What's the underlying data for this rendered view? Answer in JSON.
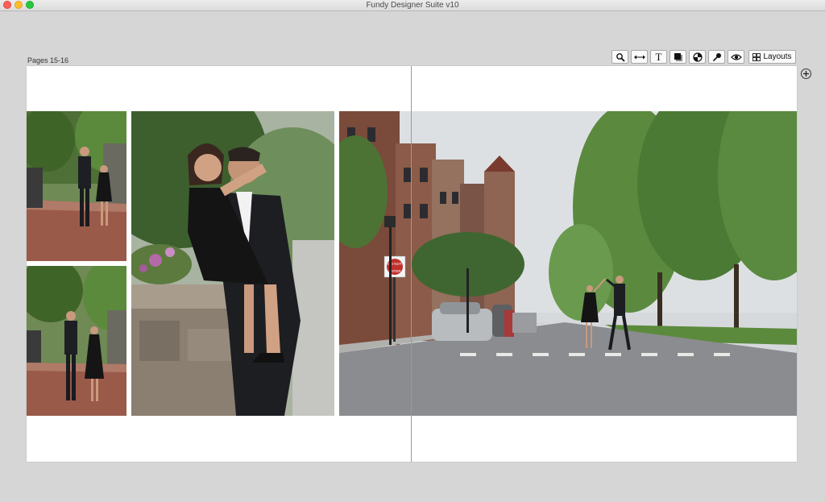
{
  "window": {
    "title": "Fundy Designer Suite v10"
  },
  "spread": {
    "page_label": "Pages 15-16"
  },
  "toolbar": {
    "buttons": [
      {
        "name": "zoom-tool-button",
        "icon": "magnifier-icon"
      },
      {
        "name": "swap-tool-button",
        "icon": "double-arrow-icon"
      },
      {
        "name": "text-tool-button",
        "icon": "text-icon",
        "label": "T"
      },
      {
        "name": "shadow-tool-button",
        "icon": "drop-shadow-icon"
      },
      {
        "name": "color-tool-button",
        "icon": "color-wheel-icon"
      },
      {
        "name": "picker-tool-button",
        "icon": "eyedropper-icon"
      },
      {
        "name": "preview-tool-button",
        "icon": "eye-icon"
      }
    ],
    "layouts_label": "Layouts"
  },
  "photos": [
    {
      "name": "couple-walking-photo-top",
      "subject": "couple walking on brick sidewalk"
    },
    {
      "name": "couple-walking-photo-bottom",
      "subject": "couple holding hands on sidewalk"
    },
    {
      "name": "couple-embrace-photo",
      "subject": "woman held by man near stone wall"
    },
    {
      "name": "street-dance-photo",
      "subject": "couple dancing in tree-lined street"
    }
  ],
  "street_sign": {
    "line1": "DO NOT",
    "line2": "ENTER"
  },
  "colors": {
    "background": "#d6d6d6",
    "page": "#ffffff",
    "gutter": "#9a9a9a"
  }
}
